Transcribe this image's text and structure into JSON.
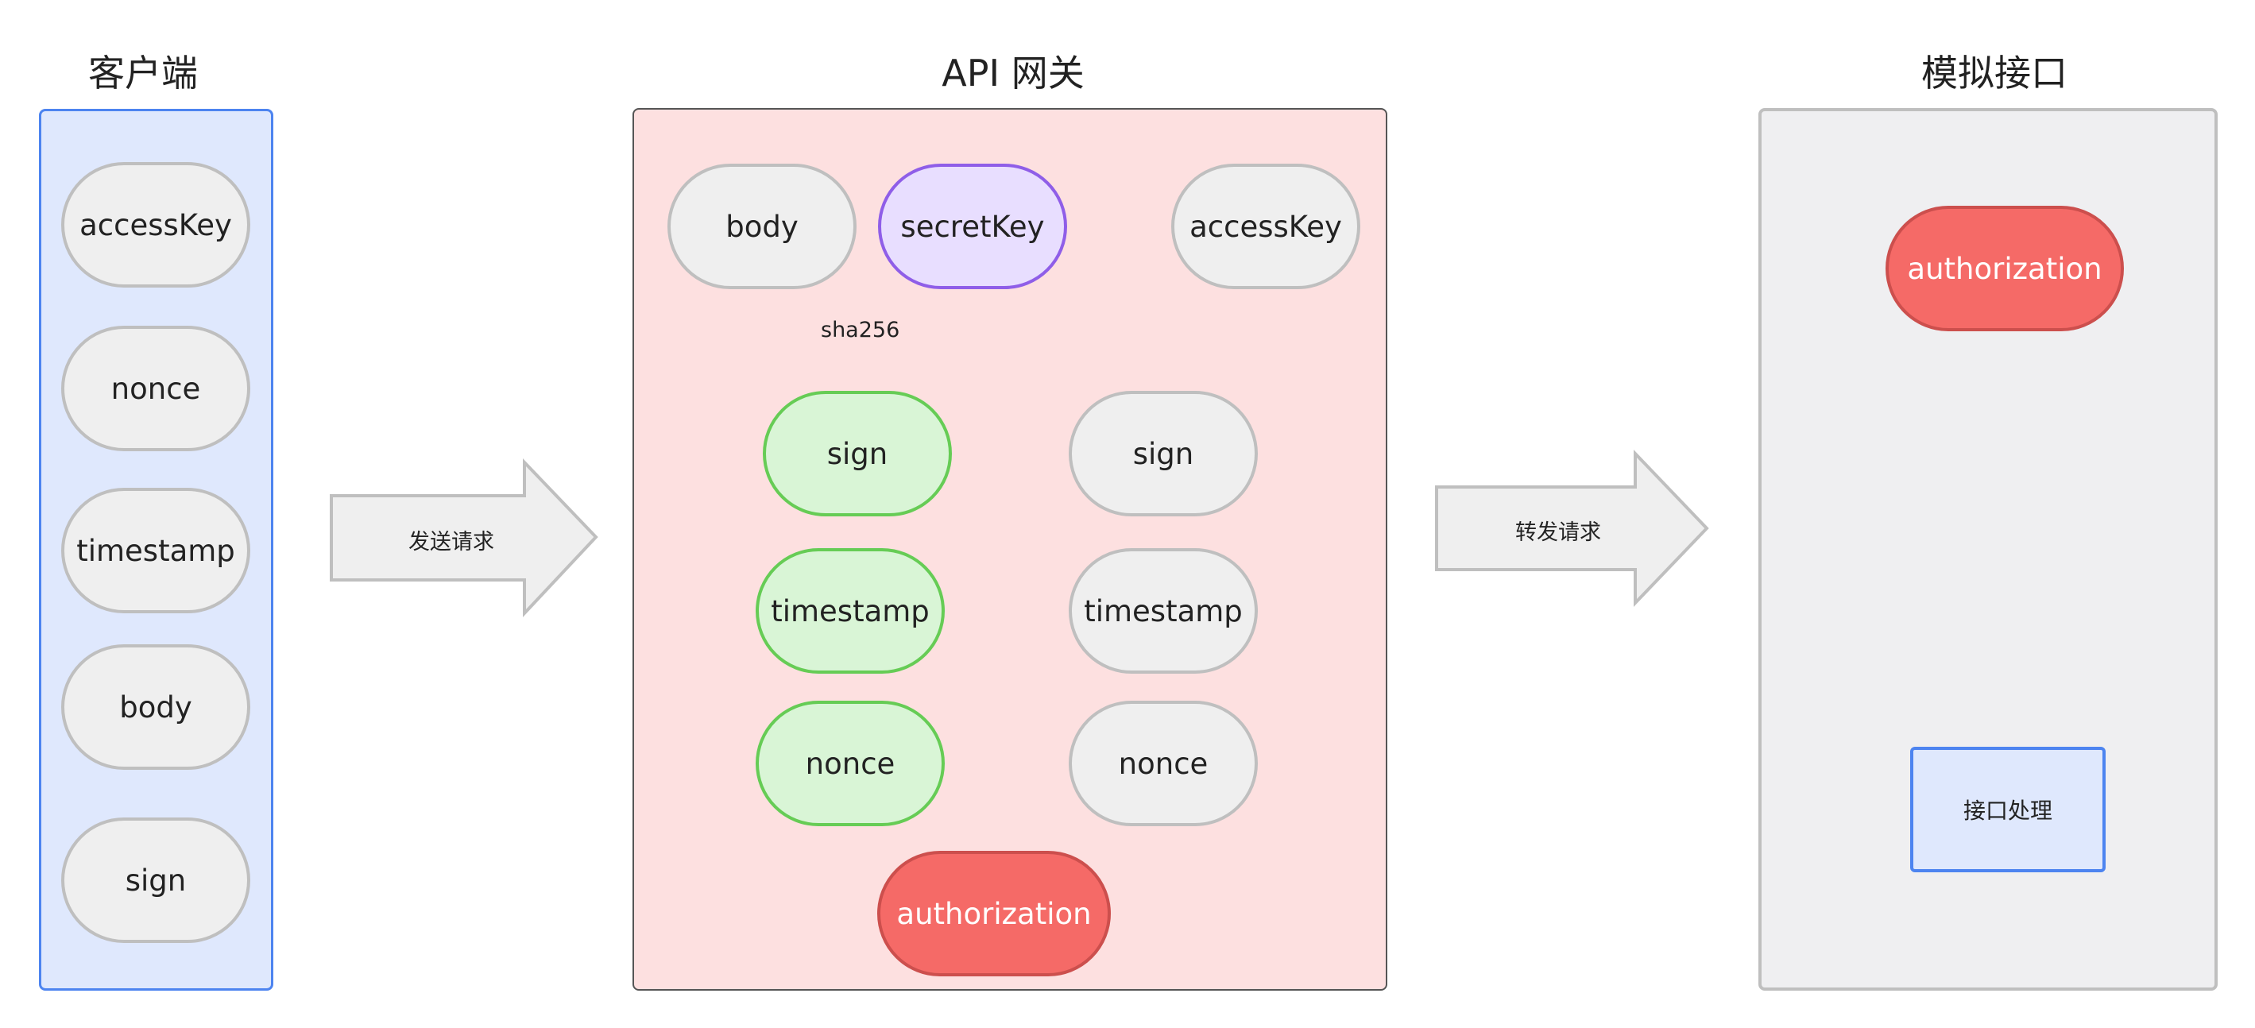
{
  "titles": {
    "client": "客户端",
    "gateway": "API 网关",
    "mock": "模拟接口"
  },
  "client": {
    "items": [
      "accessKey",
      "nonce",
      "timestamp",
      "body",
      "sign"
    ]
  },
  "gateway": {
    "body": "body",
    "secretKey": "secretKey",
    "accessKey": "accessKey",
    "hash_label": "sha256",
    "sign_computed": "sign",
    "sign_received": "sign",
    "timestamp_check": "timestamp",
    "timestamp_received": "timestamp",
    "nonce_check": "nonce",
    "nonce_received": "nonce",
    "authorization": "authorization"
  },
  "arrows": {
    "send_request": "发送请求",
    "forward_request": "转发请求"
  },
  "mock": {
    "authorization": "authorization",
    "handler": "接口处理"
  },
  "colors": {
    "client_panel": "#dfe8fd",
    "gateway_panel": "#fde0e0",
    "mock_panel": "#efeff1",
    "verified": "#d9f5d6",
    "secret": "#e8deff",
    "authorization": "#f56a67"
  }
}
